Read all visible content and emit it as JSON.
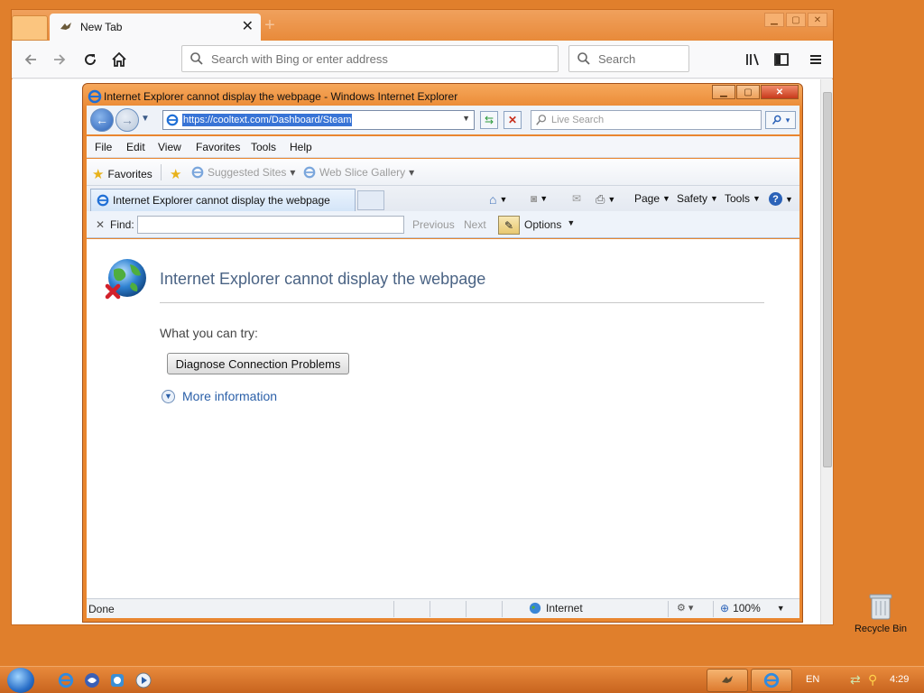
{
  "firefox": {
    "tab_title": "New Tab",
    "url_placeholder": "Search with Bing or enter address",
    "search_placeholder": "Search"
  },
  "ie": {
    "window_title": "Internet Explorer cannot display the webpage - Windows Internet Explorer",
    "address_url": "https://cooltext.com/Dashboard/Steam",
    "live_search_placeholder": "Live Search",
    "menu": [
      "File",
      "Edit",
      "View",
      "Favorites",
      "Tools",
      "Help"
    ],
    "favorites_label": "Favorites",
    "suggested_sites": "Suggested Sites",
    "web_slice_gallery": "Web Slice Gallery",
    "tab_title": "Internet Explorer cannot display the webpage",
    "commands": {
      "page": "Page",
      "safety": "Safety",
      "tools": "Tools"
    },
    "find": {
      "close": "✕",
      "label": "Find:",
      "previous": "Previous",
      "next": "Next",
      "options": "Options"
    },
    "page": {
      "heading": "Internet Explorer cannot display the webpage",
      "what_you_can_try": "What you can try:",
      "diagnose_button": "Diagnose Connection Problems",
      "more_info": "More information"
    },
    "status": {
      "left": "Done",
      "zone": "Internet",
      "zoom": "100%"
    }
  },
  "desktop": {
    "recycle_bin": "Recycle Bin",
    "language": "EN",
    "clock": "4:29"
  },
  "colors": {
    "desktop": "#e07f2c",
    "ie_title_text": "#4a6384",
    "link": "#2a5fa8"
  }
}
